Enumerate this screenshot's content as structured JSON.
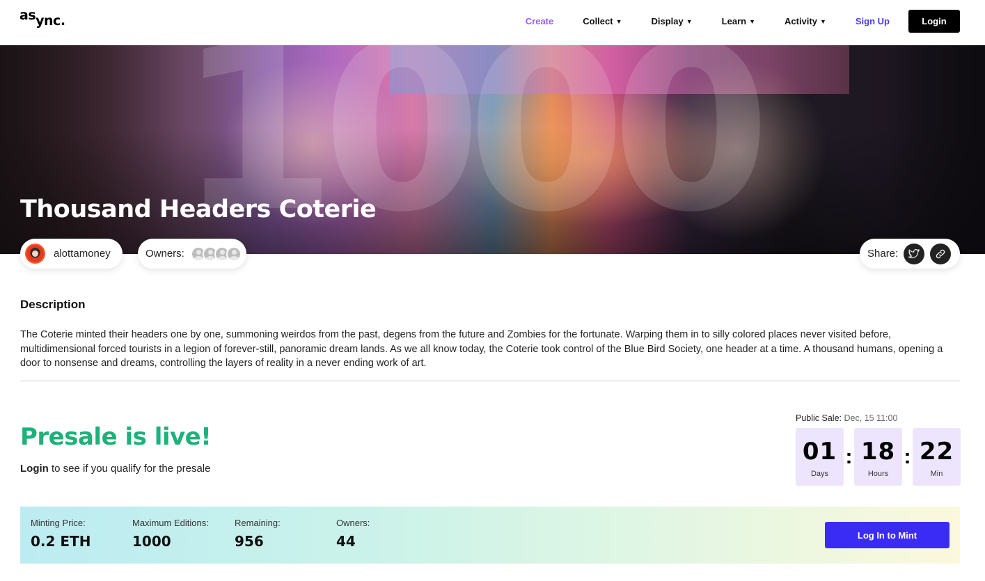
{
  "header": {
    "logo_part1": "as",
    "logo_part2": "ync.",
    "nav": {
      "create": "Create",
      "collect": "Collect",
      "display": "Display",
      "learn": "Learn",
      "activity": "Activity",
      "signup": "Sign Up",
      "login": "Login"
    }
  },
  "banner": {
    "background_numeral": "1000",
    "title": "Thousand Headers Coterie"
  },
  "creator": {
    "name": "alottamoney"
  },
  "owners_pill": {
    "label": "Owners:"
  },
  "share": {
    "label": "Share:",
    "icons": [
      "twitter-icon",
      "link-icon"
    ]
  },
  "description": {
    "heading": "Description",
    "text": "The Coterie minted their headers one by one, summoning weirdos from the past, degens from the future and Zombies for the fortunate. Warping them in to silly colored places never visited before, multidimensional forced tourists in a legion of forever-still, panoramic dream lands. As we all know today, the Coterie took control of the Blue Bird Society, one header at a time. A thousand humans, opening a door to nonsense and dreams, controlling the layers of reality in a never ending work of art."
  },
  "presale": {
    "title": "Presale is live!",
    "login_link": "Login",
    "sub_text": " to see if you qualify for the presale"
  },
  "public_sale": {
    "label": "Public Sale:",
    "date": " Dec, 15 11:00",
    "countdown": [
      {
        "value": "01",
        "unit": "Days"
      },
      {
        "value": "18",
        "unit": "Hours"
      },
      {
        "value": "22",
        "unit": "Min"
      }
    ]
  },
  "mint": {
    "stats": [
      {
        "label": "Minting Price:",
        "value": "0.2 ETH"
      },
      {
        "label": "Maximum Editions:",
        "value": "1000"
      },
      {
        "label": "Remaining:",
        "value": "956"
      },
      {
        "label": "Owners:",
        "value": "44"
      }
    ],
    "button": "Log In to Mint"
  },
  "colors": {
    "accent_purple": "#9c5bff",
    "signup_blue": "#4a3cf5",
    "presale_green": "#1db27a",
    "mint_button": "#3b2cf5",
    "countdown_bg": "#ede5fd"
  }
}
